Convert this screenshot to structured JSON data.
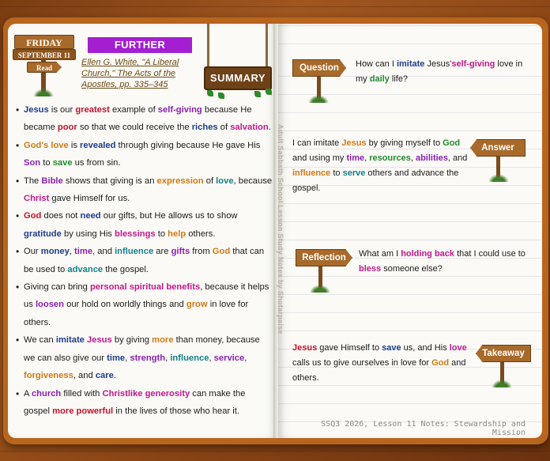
{
  "header": {
    "day": "FRIDAY",
    "date": "SEPTEMBER 11",
    "read_label": "Read",
    "badge": "FURTHER THOUGHT",
    "reference": "Ellen G. White, \"A Liberal Church,\" The Acts of the Apostles, pp. 335–345",
    "summary_label": "SUMMARY"
  },
  "vertical_text": "Adult Sabbath School Lesson Study Notes by Shotarpaise",
  "bullets": [
    [
      [
        "Jesus",
        "blue"
      ],
      [
        " is our ",
        ""
      ],
      [
        "greatest",
        "red"
      ],
      [
        " example of ",
        ""
      ],
      [
        "self-giving",
        "purple"
      ],
      [
        " because He became ",
        ""
      ],
      [
        "poor",
        "red"
      ],
      [
        " so that we could receive the ",
        ""
      ],
      [
        "riches",
        "blue"
      ],
      [
        " of ",
        ""
      ],
      [
        "salvation",
        "magenta"
      ],
      [
        ".",
        ""
      ]
    ],
    [
      [
        "God's love",
        "orange"
      ],
      [
        " is ",
        ""
      ],
      [
        "revealed",
        "blue"
      ],
      [
        " through giving because He gave His ",
        ""
      ],
      [
        "Son",
        "purple"
      ],
      [
        " to ",
        ""
      ],
      [
        "save",
        "green"
      ],
      [
        " us from sin.",
        ""
      ]
    ],
    [
      [
        "The ",
        ""
      ],
      [
        "Bible",
        "purple"
      ],
      [
        " shows that giving is an ",
        ""
      ],
      [
        "expression",
        "orange"
      ],
      [
        " of ",
        ""
      ],
      [
        "love",
        "teal"
      ],
      [
        ", because ",
        ""
      ],
      [
        "Christ",
        "magenta"
      ],
      [
        " gave Himself for us.",
        ""
      ]
    ],
    [
      [
        "God",
        "red"
      ],
      [
        " does not ",
        ""
      ],
      [
        "need",
        "blue"
      ],
      [
        " our gifts, but He allows us to show ",
        ""
      ],
      [
        "gratitude",
        "blue"
      ],
      [
        " by using His ",
        ""
      ],
      [
        "blessings",
        "magenta"
      ],
      [
        " to ",
        ""
      ],
      [
        "help",
        "orange"
      ],
      [
        " others.",
        ""
      ]
    ],
    [
      [
        "Our ",
        ""
      ],
      [
        "money",
        "blue"
      ],
      [
        ", ",
        ""
      ],
      [
        "time",
        "purple"
      ],
      [
        ", and ",
        ""
      ],
      [
        "influence",
        "teal"
      ],
      [
        " are ",
        ""
      ],
      [
        "gifts",
        "purple"
      ],
      [
        " from ",
        ""
      ],
      [
        "God",
        "orange"
      ],
      [
        " that can be used to ",
        ""
      ],
      [
        "advance",
        "teal"
      ],
      [
        " the gospel.",
        ""
      ]
    ],
    [
      [
        "Giving can bring ",
        ""
      ],
      [
        "personal spiritual benefits",
        "magenta"
      ],
      [
        ", because it helps us ",
        ""
      ],
      [
        "loosen",
        "purple"
      ],
      [
        " our hold on worldly things and ",
        ""
      ],
      [
        "grow",
        "orange"
      ],
      [
        " in love for others.",
        ""
      ]
    ],
    [
      [
        "We can ",
        ""
      ],
      [
        "imitate",
        "blue"
      ],
      [
        " ",
        ""
      ],
      [
        "Jesus",
        "magenta"
      ],
      [
        " by giving ",
        ""
      ],
      [
        "more",
        "orange"
      ],
      [
        " than money, because we can also give our ",
        ""
      ],
      [
        "time",
        "blue"
      ],
      [
        ", ",
        ""
      ],
      [
        "strength",
        "purple"
      ],
      [
        ", ",
        ""
      ],
      [
        "influence",
        "teal"
      ],
      [
        ", ",
        ""
      ],
      [
        "service",
        "purple"
      ],
      [
        ", ",
        ""
      ],
      [
        "forgiveness",
        "orange"
      ],
      [
        ", and ",
        ""
      ],
      [
        "care",
        "blue"
      ],
      [
        ".",
        ""
      ]
    ],
    [
      [
        "A ",
        ""
      ],
      [
        "church",
        "purple"
      ],
      [
        " filled with ",
        ""
      ],
      [
        "Christlike generosity",
        "magenta"
      ],
      [
        " can make the gospel ",
        ""
      ],
      [
        "more powerful",
        "red"
      ],
      [
        " in the lives of those who hear it.",
        ""
      ]
    ]
  ],
  "sections": [
    {
      "label": "Question",
      "text": [
        [
          "How can I ",
          ""
        ],
        [
          "imitate",
          "blue"
        ],
        [
          " Jesus'",
          ""
        ],
        [
          "self-giving",
          "magenta"
        ],
        [
          " love in my ",
          ""
        ],
        [
          "daily",
          "green"
        ],
        [
          " life?",
          ""
        ]
      ]
    },
    {
      "label": "Answer",
      "text": [
        [
          "I can imitate ",
          ""
        ],
        [
          "Jesus",
          "orange"
        ],
        [
          " by giving myself to ",
          ""
        ],
        [
          "God",
          "green"
        ],
        [
          " and using my ",
          ""
        ],
        [
          "time",
          "purple"
        ],
        [
          ", ",
          ""
        ],
        [
          "resources",
          "green"
        ],
        [
          ", ",
          ""
        ],
        [
          "abilities",
          "purple"
        ],
        [
          ", and ",
          ""
        ],
        [
          "influence",
          "orange"
        ],
        [
          " to ",
          ""
        ],
        [
          "serve",
          "teal"
        ],
        [
          " others and advance the gospel.",
          ""
        ]
      ]
    },
    {
      "label": "Reflection",
      "text": [
        [
          "What am I ",
          ""
        ],
        [
          "holding back",
          "magenta"
        ],
        [
          " that I could use to ",
          ""
        ],
        [
          "bless",
          "magenta"
        ],
        [
          " someone else?",
          ""
        ]
      ]
    },
    {
      "label": "Takeaway",
      "text": [
        [
          "Jesus",
          "red"
        ],
        [
          " gave Himself to ",
          ""
        ],
        [
          "save",
          "blue"
        ],
        [
          " us, and His ",
          ""
        ],
        [
          "love",
          "magenta"
        ],
        [
          " calls us to give ourselves in love for ",
          ""
        ],
        [
          "God",
          "orange"
        ],
        [
          " and others.",
          ""
        ]
      ]
    }
  ],
  "footer": "SSQ3 2026, Lesson 11 Notes: Stewardship and Mission",
  "colors": {
    "badge": "#a41fd0",
    "wood": "#a86a2a",
    "page": "#fbfaf6"
  }
}
